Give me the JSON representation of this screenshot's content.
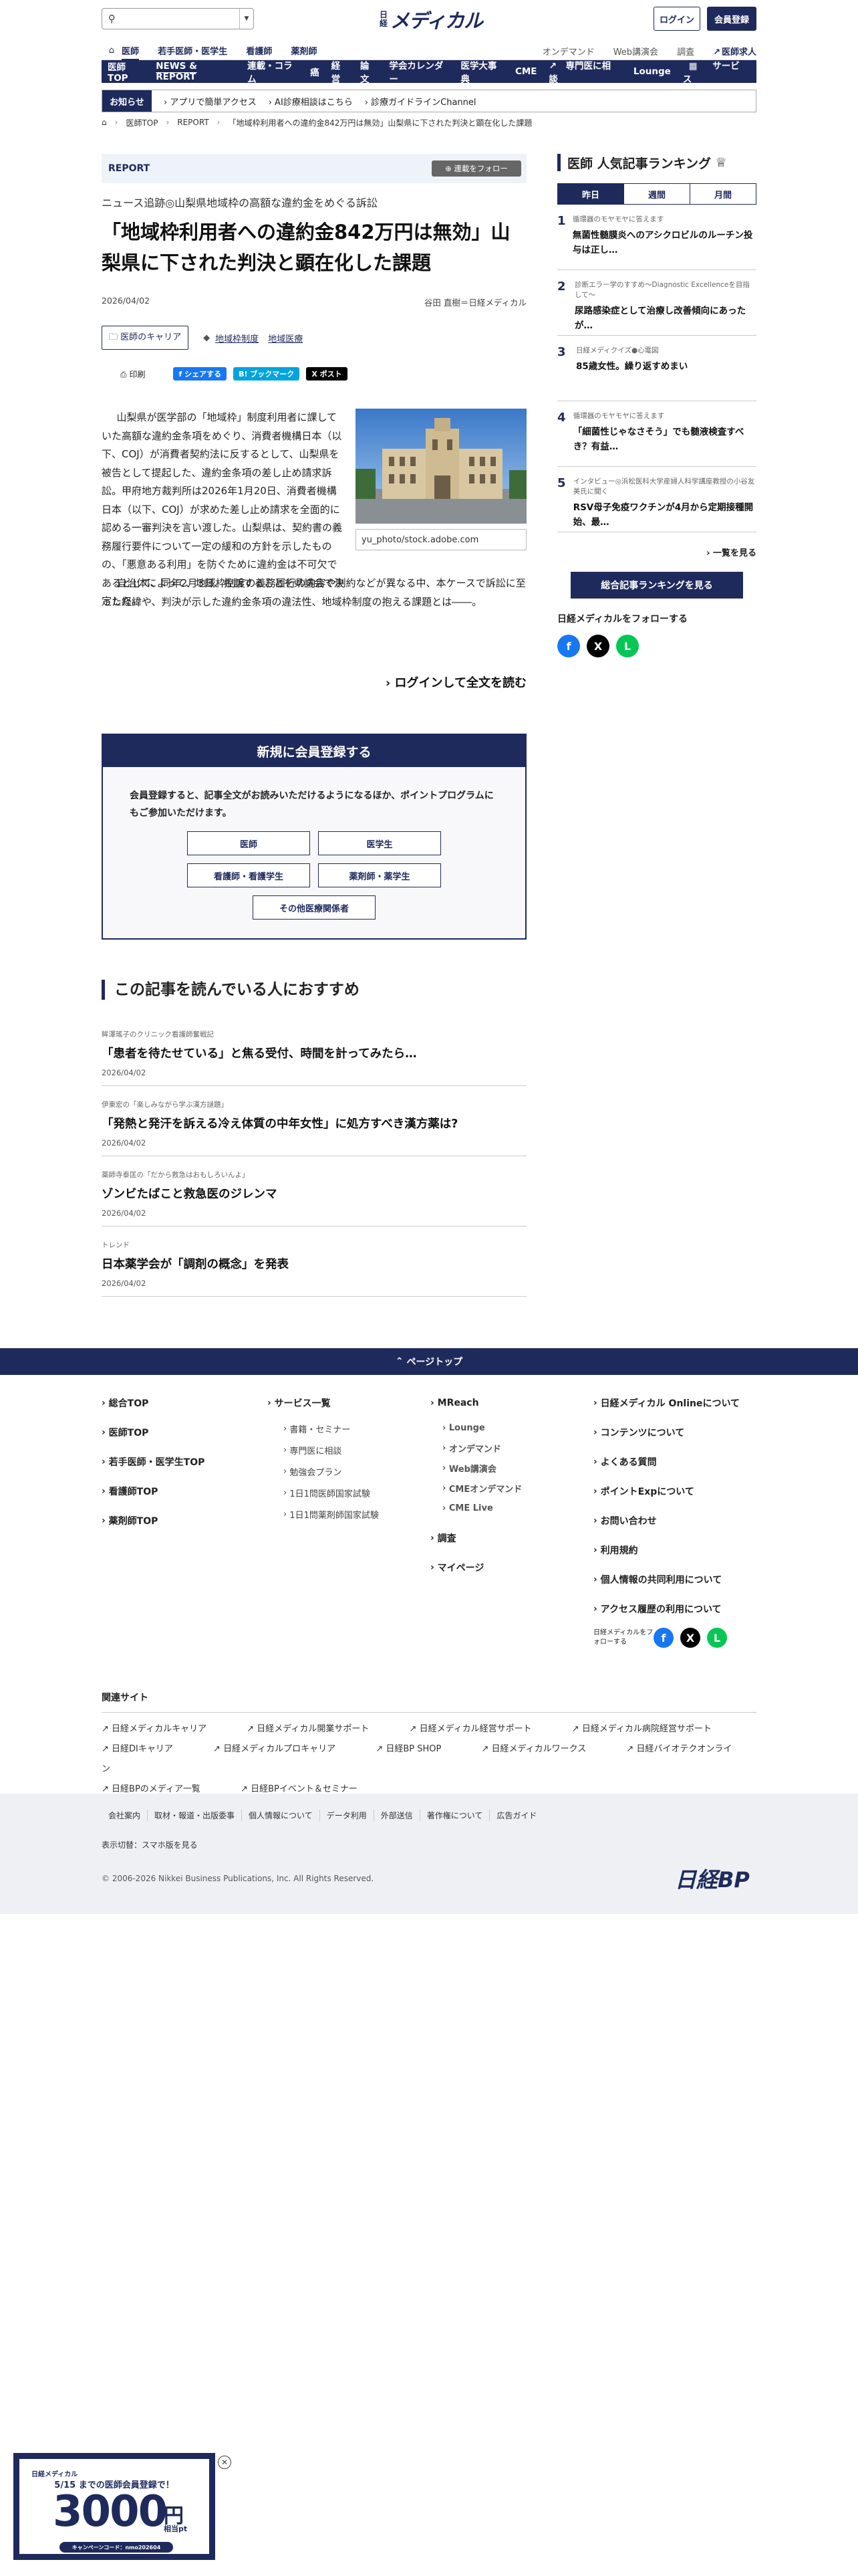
{
  "header": {
    "logo_small": "日経",
    "logo_main": "メディカル",
    "search_placeholder": "",
    "login_label": "ログイン",
    "register_label": "会員登録"
  },
  "nav1": {
    "items": [
      "医師",
      "若手医師・医学生",
      "看護師",
      "薬剤師"
    ],
    "right": [
      "オンデマンド",
      "Web講演会",
      "調査"
    ],
    "job": "医師求人"
  },
  "nav2": {
    "items": [
      "医師TOP",
      "NEWS & REPORT",
      "連載・コラム",
      "癌",
      "経営",
      "論文",
      "学会カレンダー",
      "医学大事典",
      "CME",
      "専門医に相談",
      "Lounge"
    ],
    "service": "サービス"
  },
  "notice": {
    "label": "お知らせ",
    "items": [
      "アプリで簡単アクセス",
      "AI診療相談はこちら",
      "診療ガイドラインChannel"
    ]
  },
  "breadcrumb": [
    "医師TOP",
    "REPORT",
    "「地域枠利用者への違約金842万円は無効」山梨県に下された判決と顕在化した課題"
  ],
  "article": {
    "section": "REPORT",
    "follow_label": "連載をフォロー",
    "kicker": "ニュース追跡◎山梨県地域枠の高額な違約金をめぐる訴訟",
    "title": "「地域枠利用者への違約金842万円は無効」山梨県に下された判決と顕在化した課題",
    "date": "2026/04/02",
    "author": "谷田 直樹＝日経メディカル",
    "category": "医師のキャリア",
    "tags": [
      "地域枠制度",
      "地域医療"
    ],
    "print": "印刷",
    "share_fb": "シェアする",
    "share_hb": "ブックマーク",
    "share_x": "ポスト",
    "para1": "山梨県が医学部の「地域枠」制度利用者に課していた高額な違約金条項をめぐり、消費者機構日本（以下、COJ）が消費者契約法に反するとして、山梨県を被告として提起した、違約金条項の差し止め請求訴訟。甲府地方裁判所は2026年1月20日、消費者機構日本（以下、COJ）が求めた差し止め請求を全面的に認める一審判決を言い渡した。山梨県は、契約書の義務履行要件について一定の緩和の方針を示したものの、「悪意ある利用」を防ぐために違約金は不可欠であるとして、同年2月3日、控訴することを県議会で決定した。",
    "photo_credit": "yu_photo/stock.adobe.com",
    "para2": "自治体によって、地域枠制度の義務履行の内容や制約などが異なる中、本ケースで訴訟に至った経緯や、判決が示した違約金条項の違法性、地域枠制度の抱える課題とは――。",
    "readmore": "ログインして全文を読む"
  },
  "register": {
    "heading": "新規に会員登録する",
    "text": "会員登録すると、記事全文がお読みいただけるようになるほか、ポイントプログラムにもご参加いただけます。",
    "buttons": [
      "医師",
      "医学生",
      "看護師・看護学生",
      "薬剤師・薬学生",
      "その他医療関係者"
    ]
  },
  "recommend": {
    "heading": "この記事を読んでいる人におすすめ",
    "items": [
      {
        "series": "眸澤瑤子のクリニック看護師奮戦記",
        "title": "「患者を待たせている」と焦る受付、時間を計ってみたら…",
        "date": "2026/04/02"
      },
      {
        "series": "伊東宏の「楽しみながら学ぶ漢方謎題」",
        "title": "「発熱と発汗を訴える冷え体質の中年女性」に処方すべき漢方薬は?",
        "date": "2026/04/02"
      },
      {
        "series": "薬師寺泰匡の「だから救急はおもしろいんよ」",
        "title": "ゾンビたばこと救急医のジレンマ",
        "date": "2026/04/02"
      },
      {
        "series": "トレンド",
        "title": "日本薬学会が「調剤の概念」を発表",
        "date": "2026/04/02"
      }
    ]
  },
  "ranking": {
    "heading": "医師 人気記事ランキング",
    "tabs": [
      "昨日",
      "週間",
      "月間"
    ],
    "items": [
      {
        "n": "1",
        "sub": "循環器のモヤモヤに答えます",
        "title": "無菌性髄膜炎へのアシクロビルのルーチン投与は正し…"
      },
      {
        "n": "2",
        "sub": "診断エラー学のすすめ〜Diagnostic Excellenceを目指して〜",
        "title": "尿路感染症として治療し改善傾向にあったが…"
      },
      {
        "n": "3",
        "sub": "日経メディクイズ●心電図",
        "title": "85歳女性。繰り返すめまい"
      },
      {
        "n": "4",
        "sub": "循環器のモヤモヤに答えます",
        "title": "「細菌性じゃなさそう」でも髄液検査すべき？有益…"
      },
      {
        "n": "5",
        "sub": "インタビュー◎浜松医科大学産婦人科学講座教授の小谷友美氏に聞く",
        "title": "RSV母子免疫ワクチンが4月から定期接種開始、最…"
      }
    ],
    "more": "一覧を見る",
    "all_button": "総合記事ランキングを見る",
    "follow": "日経メディカルをフォローする"
  },
  "footer": {
    "pagetop": "ページトップ",
    "col1": [
      "総合TOP",
      "医師TOP",
      "若手医師・医学生TOP",
      "看護師TOP",
      "薬剤師TOP"
    ],
    "col2_head": "サービス一覧",
    "col2": [
      "書籍・セミナー",
      "専門医に相談",
      "勉強会プラン",
      "1日1問医師国家試験",
      "1日1問薬剤師国家試験"
    ],
    "col3_head": "MReach",
    "col3": [
      "Lounge",
      "オンデマンド",
      "Web講演会",
      "CMEオンデマンド",
      "CME Live"
    ],
    "col3_b": [
      "調査",
      "マイページ"
    ],
    "col4": [
      "日経メディカル Onlineについて",
      "コンテンツについて",
      "よくある質問",
      "ポイントExpについて",
      "お問い合わせ",
      "利用規約",
      "個人情報の共同利用について",
      "アクセス履歴の利用について"
    ],
    "follow_small": "日経メディカルをフォローする",
    "related_head": "関連サイト",
    "related": [
      "日経メディカルキャリア",
      "日経メディカル開業サポート",
      "日経メディカル経営サポート",
      "日経メディカル病院経営サポート",
      "日経DIキャリア",
      "日経メディカルプロキャリア",
      "日経BP SHOP",
      "日経メディカルワークス",
      "日経バイオテクオンライン",
      "日経BPのメディア一覧",
      "日経BPイベント＆セミナー"
    ],
    "bottom_links": [
      "会社案内",
      "取材・報道・出版委事",
      "個人情報について",
      "データ利用",
      "外部送信",
      "著作権について",
      "広告ガイド"
    ],
    "switch": "表示切替：スマホ版を見る",
    "copyright": "© 2006-2026 Nikkei Business Publications, Inc. All Rights Reserved.",
    "bp": "日経BP"
  },
  "ad": {
    "brand": "日経メディカル",
    "line1": "5/15 までの医師会員登録で！",
    "amount": "3000",
    "unit": "円",
    "sub": "相当pt",
    "code": "キャンペーンコード：nmo202604"
  }
}
